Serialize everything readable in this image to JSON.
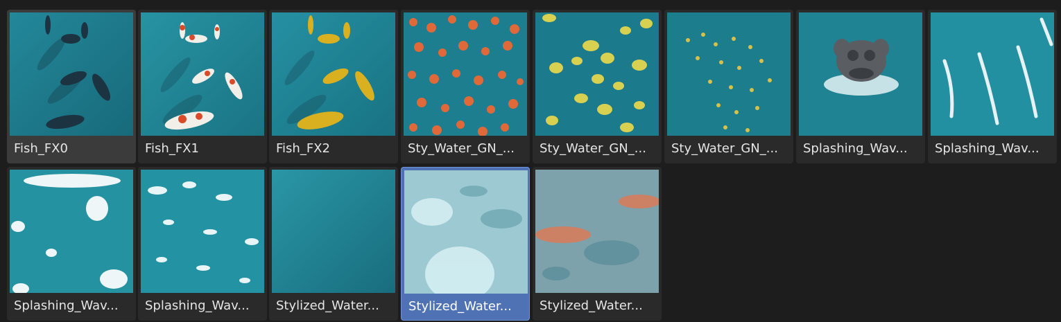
{
  "asset_browser": {
    "items": [
      {
        "label": "Fish_FX0",
        "thumbnail": "fish-dark-icon"
      },
      {
        "label": "Fish_FX1",
        "thumbnail": "fish-koi-icon"
      },
      {
        "label": "Fish_FX2",
        "thumbnail": "fish-gold-icon"
      },
      {
        "label": "Sty_Water_GN_...",
        "thumbnail": "orange-leaves-icon"
      },
      {
        "label": "Sty_Water_GN_...",
        "thumbnail": "lily-pads-icon"
      },
      {
        "label": "Sty_Water_GN_...",
        "thumbnail": "yellow-petals-icon"
      },
      {
        "label": "Splashing_Wav...",
        "thumbnail": "monkey-splash-icon"
      },
      {
        "label": "Splashing_Wav...",
        "thumbnail": "wave-streaks-icon"
      },
      {
        "label": "Splashing_Wav...",
        "thumbnail": "wave-foam-icon"
      },
      {
        "label": "Splashing_Wav...",
        "thumbnail": "wave-foam-light-icon"
      },
      {
        "label": "Stylized_Water...",
        "thumbnail": "deep-water-icon"
      },
      {
        "label": "Stylized_Water...",
        "thumbnail": "pale-swirl-icon"
      },
      {
        "label": "Stylized_Water...",
        "thumbnail": "orange-swirl-icon"
      }
    ],
    "hovered_index": 0,
    "selected_index": 11
  },
  "colors": {
    "background": "#1d1d1d",
    "tile": "#2a2a2a",
    "tile_hover": "#3b3b3b",
    "tile_selected": "#4e72b4",
    "label_text": "#e6e6e6"
  }
}
